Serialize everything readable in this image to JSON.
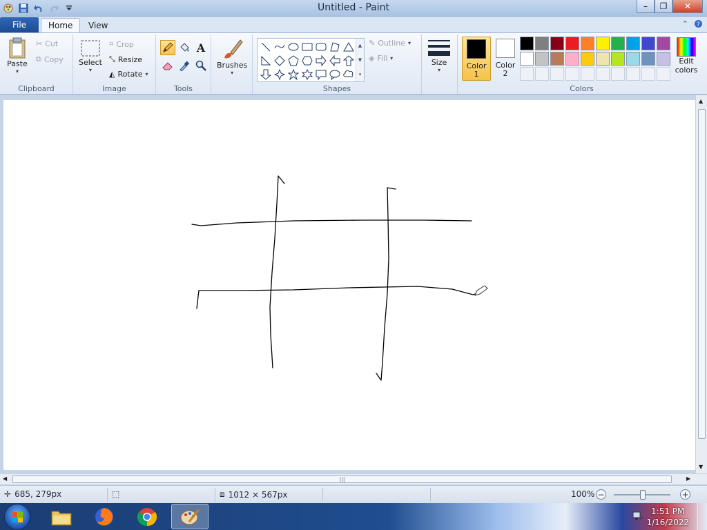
{
  "window": {
    "title": "Untitled - Paint"
  },
  "tabs": {
    "file": "File",
    "home": "Home",
    "view": "View"
  },
  "clipboard": {
    "paste": "Paste",
    "cut": "Cut",
    "copy": "Copy",
    "label": "Clipboard"
  },
  "image": {
    "select": "Select",
    "crop": "Crop",
    "resize": "Resize",
    "rotate": "Rotate",
    "label": "Image"
  },
  "tools": {
    "label": "Tools",
    "active": "pencil"
  },
  "brushes": {
    "label": "Brushes"
  },
  "shapes": {
    "outline": "Outline",
    "fill": "Fill",
    "label": "Shapes"
  },
  "size": {
    "label": "Size"
  },
  "colors": {
    "color1_label": "Color",
    "color1_num": "1",
    "color2_label": "Color",
    "color2_num": "2",
    "color1_value": "#000000",
    "color2_value": "#ffffff",
    "edit_label": "Edit",
    "edit_label2": "colors",
    "label": "Colors",
    "palette": [
      "#000000",
      "#7f7f7f",
      "#880015",
      "#ed1c24",
      "#ff7f27",
      "#fff200",
      "#22b14c",
      "#00a2e8",
      "#3f48cc",
      "#a349a4",
      "#ffffff",
      "#c3c3c3",
      "#b97a57",
      "#ffaec9",
      "#ffc90e",
      "#efe4b0",
      "#b5e61d",
      "#99d9ea",
      "#7092be",
      "#c8bfe7"
    ]
  },
  "status": {
    "cursor_pos": "685, 279px",
    "selection_size": "",
    "canvas_size": "1012 × 567px",
    "zoom": "100%"
  },
  "taskbar": {
    "time": "1:51 PM",
    "date": "1/16/2022",
    "apps": [
      "file-explorer",
      "firefox",
      "chrome",
      "paint"
    ]
  }
}
